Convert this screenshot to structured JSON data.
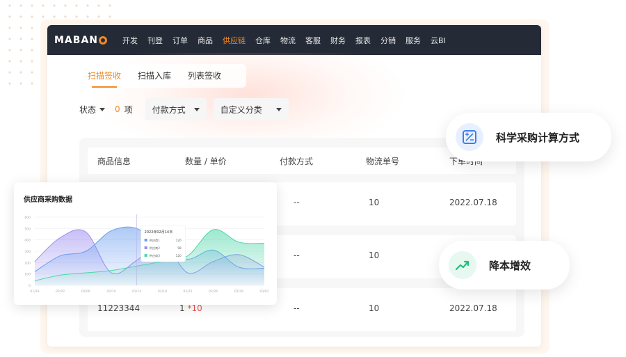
{
  "nav": {
    "logo_text": "MABAN",
    "items": [
      "开发",
      "刊登",
      "订单",
      "商品",
      "供应链",
      "仓库",
      "物流",
      "客服",
      "财务",
      "报表",
      "分销",
      "服务",
      "云BI"
    ],
    "active_index": 4
  },
  "tabs": [
    {
      "label": "扫描签收",
      "active": true
    },
    {
      "label": "扫描入库",
      "active": false
    },
    {
      "label": "列表签收",
      "active": false
    }
  ],
  "filters": {
    "status_label": "状态",
    "count": "0",
    "count_unit": "项",
    "payment_label": "付款方式",
    "category_label": "自定义分类"
  },
  "table": {
    "headers": [
      "商品信息",
      "数量 / 单价",
      "付款方式",
      "物流单号",
      "下单时间"
    ],
    "rows": [
      {
        "product": "",
        "qty": "",
        "qty_extra": "",
        "payment": "--",
        "logistics": "10",
        "date": "2022.07.18"
      },
      {
        "product": "",
        "qty": "",
        "qty_extra": "",
        "payment": "--",
        "logistics": "10",
        "date": ""
      },
      {
        "product": "11223344",
        "qty": "1",
        "qty_extra": "*10",
        "payment": "--",
        "logistics": "10",
        "date": "2022.07.18"
      }
    ]
  },
  "chart_card": {
    "title": "供应商采购数据"
  },
  "chart_data": {
    "type": "area",
    "title": "供应商采购数据",
    "y_ticks": [
      "600",
      "500",
      "400",
      "300",
      "200",
      "100",
      "0"
    ],
    "ylim": [
      0,
      600
    ],
    "x": [
      "01/29",
      "02/02",
      "02/06",
      "02/10",
      "02/14",
      "02/18",
      "02/22",
      "02/26",
      "02/29",
      "03/02"
    ],
    "series": [
      {
        "values": [
          210,
          420,
          470,
          110,
          220,
          380,
          110,
          210,
          270,
          160
        ],
        "color": "#9b8cf0"
      },
      {
        "values": [
          120,
          260,
          300,
          480,
          500,
          320,
          230,
          310,
          160,
          150
        ],
        "color": "#6b9df0"
      },
      {
        "values": [
          40,
          90,
          110,
          130,
          170,
          210,
          260,
          490,
          380,
          370
        ],
        "color": "#4ed6a8"
      }
    ],
    "tooltip": {
      "title": "2022年02月14日",
      "rows": [
        {
          "label": "供应商1",
          "value": "120",
          "color": "#6b9df0"
        },
        {
          "label": "供应商2",
          "value": "98",
          "color": "#9b8cf0"
        },
        {
          "label": "供应商3",
          "value": "120",
          "color": "#4ed6a8"
        }
      ]
    }
  },
  "feature_bubbles": [
    {
      "text": "科学采购计算方式",
      "icon": "calculator-icon",
      "color": "#3b7ff0"
    },
    {
      "text": "降本增效",
      "icon": "trend-up-icon",
      "color": "#1fbf7f"
    }
  ]
}
